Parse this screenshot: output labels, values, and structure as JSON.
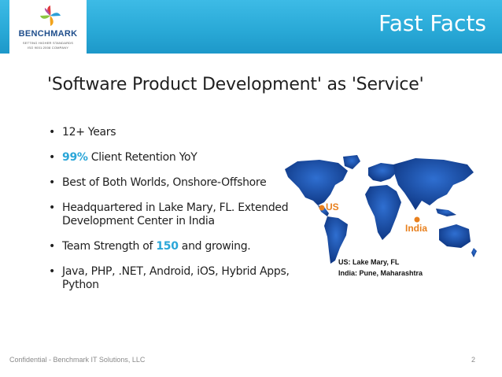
{
  "header": {
    "title": "Fast Facts",
    "logo": {
      "name": "BENCHMARK",
      "tagline_line1": "SETTING HIGHER STANDARDS",
      "tagline_line2": "ISO 9001:2008 COMPANY"
    }
  },
  "subtitle": "'Software Product Development' as 'Service'",
  "bullets": [
    {
      "pre": "",
      "highlight": "",
      "post": "12+ Years"
    },
    {
      "pre": "",
      "highlight": "99%",
      "post": " Client Retention YoY"
    },
    {
      "pre": "Best of Both Worlds, Onshore-Offshore",
      "highlight": "",
      "post": ""
    },
    {
      "line1": "Headquartered in Lake Mary, FL. Extended",
      "line2": "Development Center in India"
    },
    {
      "pre": "Team Strength of ",
      "highlight": "150",
      "post": " and growing."
    },
    {
      "line1": "Java, PHP, .NET, Android, iOS, Hybrid Apps,",
      "line2": "Python"
    }
  ],
  "map": {
    "marker_us": "US",
    "marker_india": "India",
    "caption_line1": "US: Lake Mary, FL",
    "caption_line2": "India: Pune, Maharashtra"
  },
  "footer": {
    "left": "Confidential - Benchmark IT Solutions, LLC",
    "page_number": "2"
  },
  "colors": {
    "header": "#2ea9d8",
    "highlight": "#2aa6d8",
    "marker": "#e8801e",
    "map_land": "#0d3f91"
  }
}
